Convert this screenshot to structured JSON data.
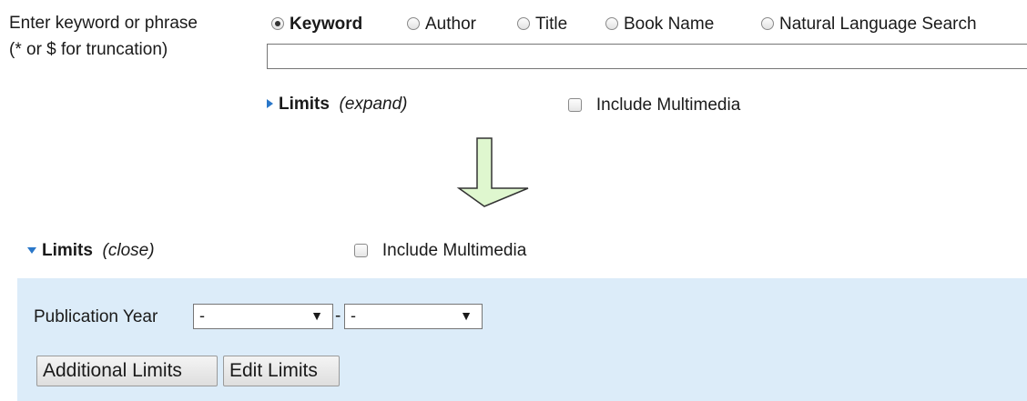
{
  "search": {
    "prompt_line1": "Enter keyword or phrase",
    "prompt_line2": "(* or $ for truncation)",
    "options": [
      {
        "label": "Keyword",
        "checked": true
      },
      {
        "label": "Author",
        "checked": false
      },
      {
        "label": "Title",
        "checked": false
      },
      {
        "label": "Book Name",
        "checked": false
      },
      {
        "label": "Natural Language Search",
        "checked": false
      }
    ],
    "input_value": ""
  },
  "limits_collapsed": {
    "label": "Limits",
    "toggle": "(expand)",
    "multimedia_label": "Include Multimedia"
  },
  "limits_expanded": {
    "label": "Limits",
    "toggle": "(close)",
    "multimedia_label": "Include Multimedia",
    "publication_year_label": "Publication Year",
    "year_from": "-",
    "year_separator": "-",
    "year_to": "-",
    "additional_limits_button": "Additional Limits",
    "edit_limits_button": "Edit Limits"
  },
  "colors": {
    "panel_background": "#dcecf9",
    "arrow_fill": "#dff7cf",
    "triangle": "#2a77c9"
  }
}
